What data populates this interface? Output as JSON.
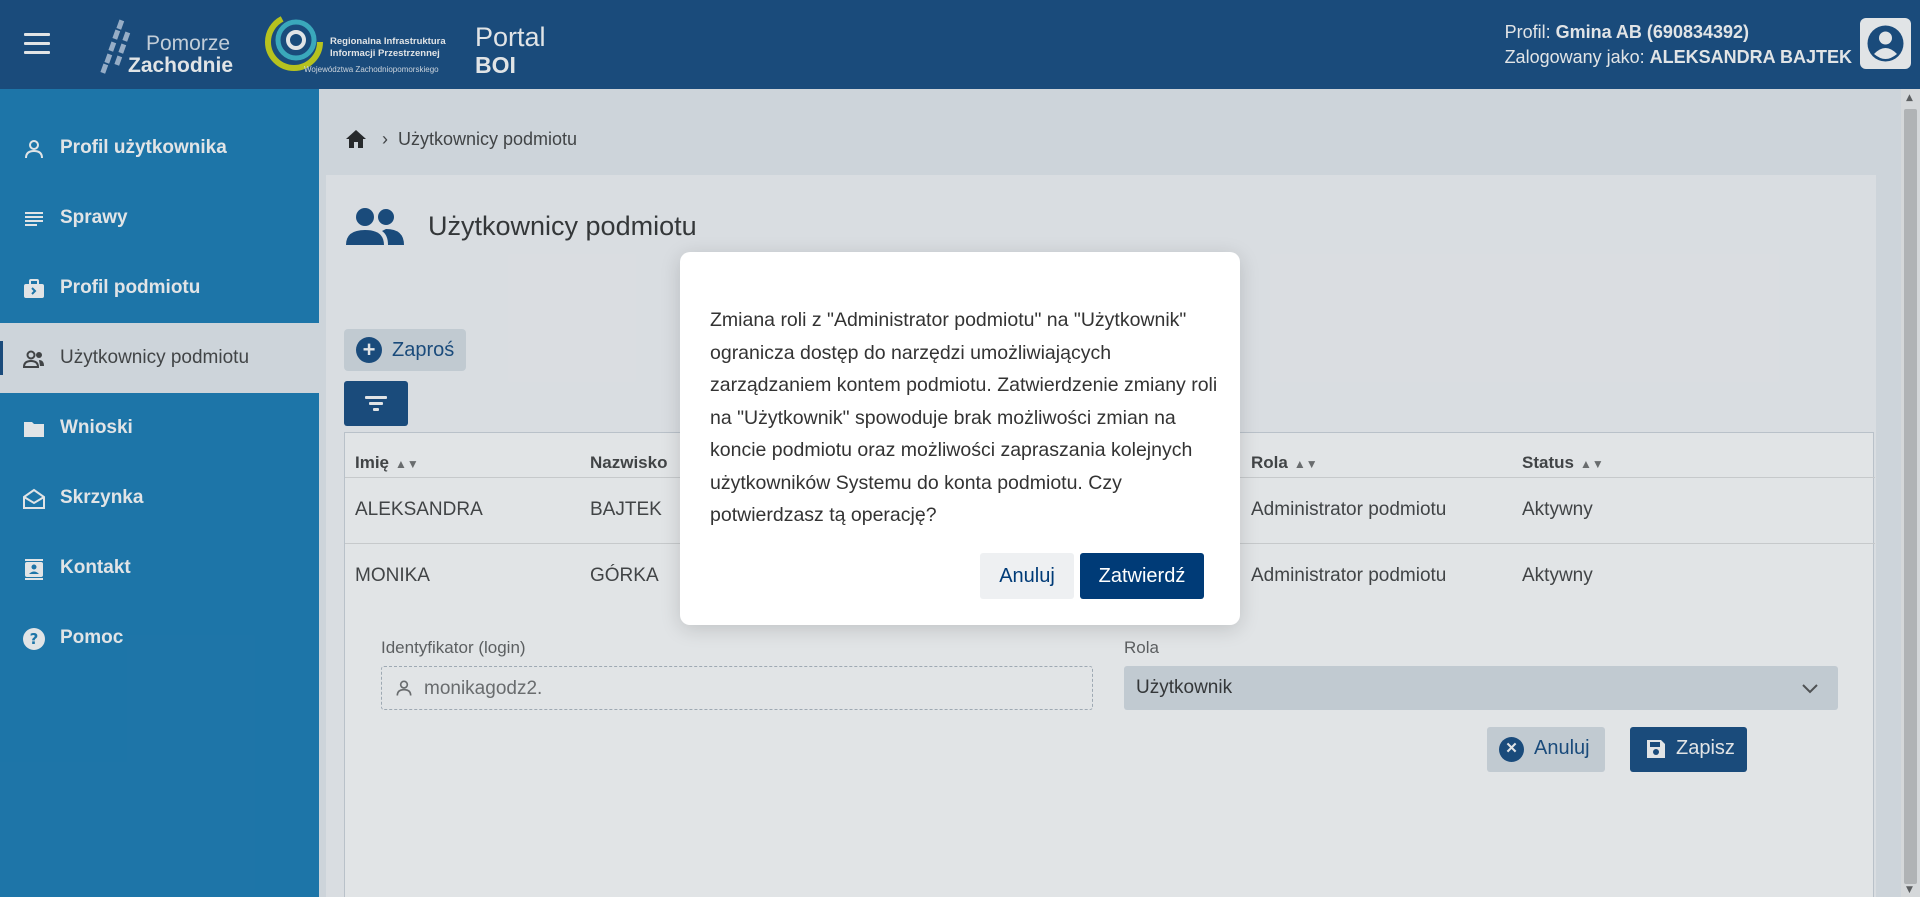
{
  "header": {
    "logo_pz_line1": "Pomorze",
    "logo_pz_line2": "Zachodnie",
    "riip_line1": "Regionalna Infrastruktura",
    "riip_line2": "Informacji Przestrzennej",
    "riip_line3": "Województwa Zachodniopomorskiego",
    "portal_line1": "Portal",
    "portal_line2": "BOI",
    "profile_label": "Profil: ",
    "profile_value": "Gmina AB (690834392)",
    "logged_label": "Zalogowany jako: ",
    "logged_value": "ALEKSANDRA BAJTEK"
  },
  "sidebar": {
    "items": [
      {
        "label": "Profil użytkownika",
        "icon": "person-icon"
      },
      {
        "label": "Sprawy",
        "icon": "list-icon"
      },
      {
        "label": "Profil podmiotu",
        "icon": "briefcase-icon"
      },
      {
        "label": "Użytkownicy podmiotu",
        "icon": "people-icon",
        "active": true
      },
      {
        "label": "Wnioski",
        "icon": "folder-icon"
      },
      {
        "label": "Skrzynka",
        "icon": "mail-open-icon"
      },
      {
        "label": "Kontakt",
        "icon": "contact-card-icon"
      },
      {
        "label": "Pomoc",
        "icon": "help-icon"
      }
    ]
  },
  "breadcrumb": {
    "current": "Użytkownicy podmiotu"
  },
  "page": {
    "title": "Użytkownicy podmiotu",
    "invite_button": "Zaproś"
  },
  "table": {
    "headers": {
      "first_name": "Imię",
      "last_name": "Nazwisko",
      "role": "Rola",
      "status": "Status"
    },
    "rows": [
      {
        "first_name": "ALEKSANDRA",
        "last_name": "BAJTEK",
        "role": "Administrator podmiotu",
        "status": "Aktywny"
      },
      {
        "first_name": "MONIKA",
        "last_name": "GÓRKA",
        "role": "Administrator podmiotu",
        "status": "Aktywny"
      }
    ]
  },
  "edit_form": {
    "login_label": "Identyfikator (login)",
    "login_value": "monikagodz2.",
    "role_label": "Rola",
    "role_value": "Użytkownik",
    "cancel_label": "Anuluj",
    "save_label": "Zapisz"
  },
  "modal": {
    "message": "Zmiana roli z \"Administrator podmiotu\" na \"Użytkownik\" ogranicza dostęp do narzędzi umożliwiających zarządzaniem kontem podmiotu. Zatwierdzenie zmiany roli na \"Użytkownik\" spowoduje brak możliwości zmian na koncie podmiotu oraz możliwości zapraszania kolejnych użytkowników Systemu do konta podmiotu. Czy potwierdzasz tą operację?",
    "cancel_label": "Anuluj",
    "confirm_label": "Zatwierdź"
  },
  "colors": {
    "header_bg": "#003b77",
    "sidebar_bg": "#0571b0",
    "accent": "#003b77",
    "page_bg": "#e6ebf0"
  }
}
